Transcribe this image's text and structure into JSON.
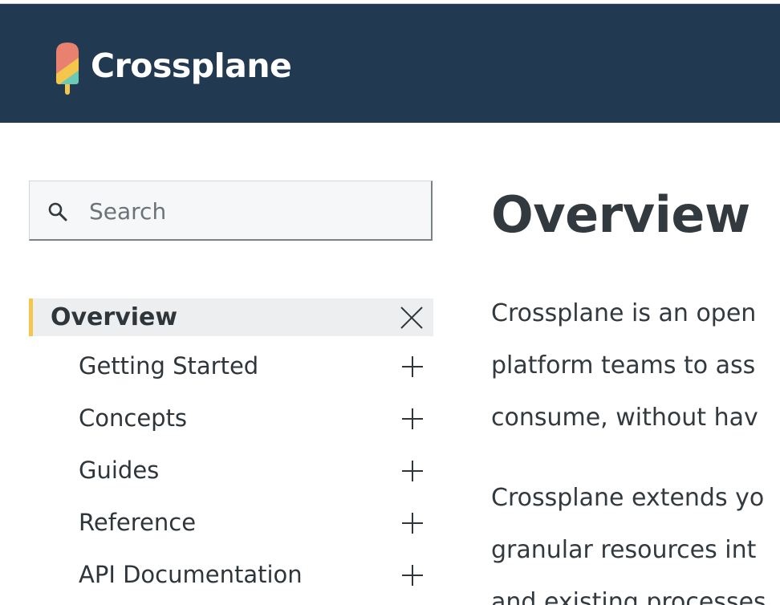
{
  "header": {
    "brand": "Crossplane",
    "colors": {
      "background": "#223a51",
      "text": "#ffffff"
    },
    "logo_icon": "popsicle-logo"
  },
  "search": {
    "placeholder": "Search",
    "value": "",
    "icon": "search-icon"
  },
  "sidebar": {
    "active_accent": "#f5c64c",
    "active": {
      "label": "Overview",
      "icon": "close-icon"
    },
    "items": [
      {
        "label": "Getting Started",
        "icon": "plus-icon"
      },
      {
        "label": "Concepts",
        "icon": "plus-icon"
      },
      {
        "label": "Guides",
        "icon": "plus-icon"
      },
      {
        "label": "Reference",
        "icon": "plus-icon"
      },
      {
        "label": "API Documentation",
        "icon": "plus-icon"
      }
    ]
  },
  "main": {
    "title": "Overview",
    "paragraphs": [
      {
        "lines": [
          "Crossplane is an open",
          "platform teams to ass",
          "consume, without hav"
        ]
      },
      {
        "lines": [
          "Crossplane extends yo",
          "granular resources int",
          "and existing processes"
        ]
      }
    ]
  }
}
